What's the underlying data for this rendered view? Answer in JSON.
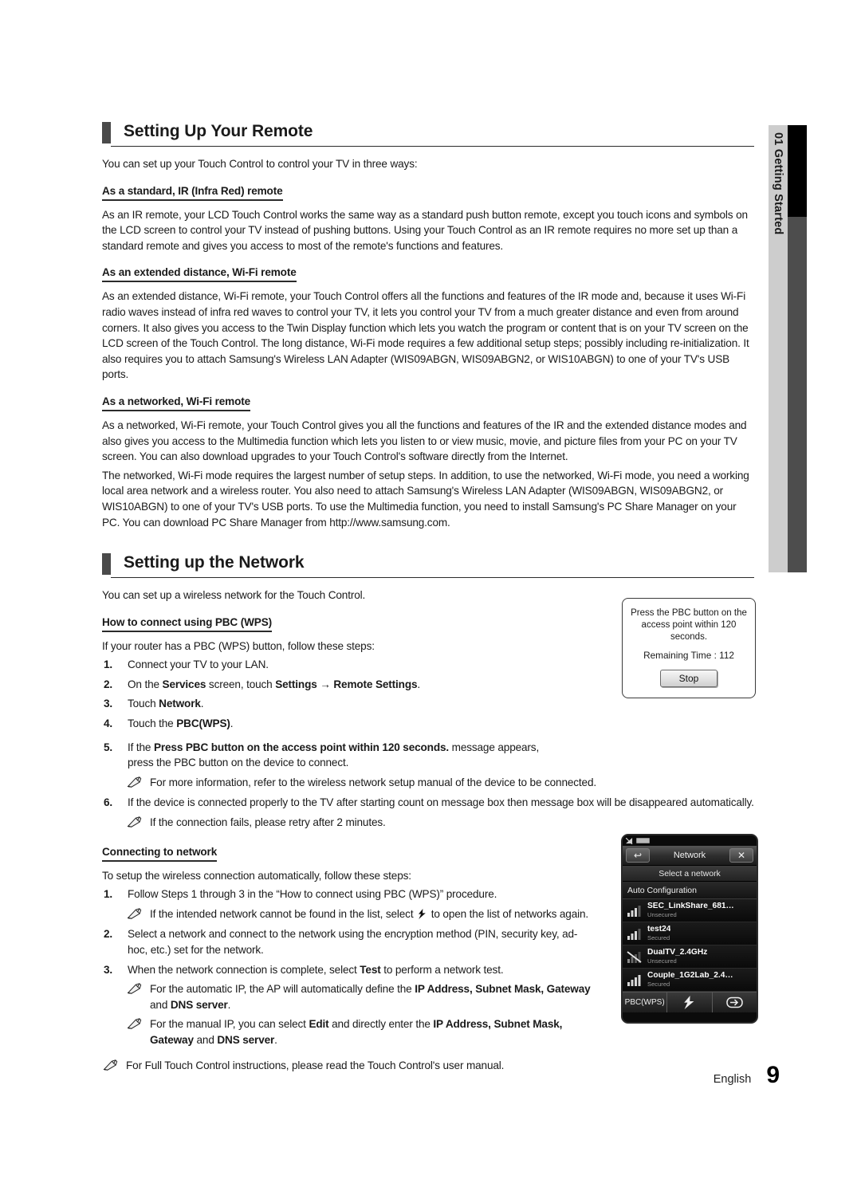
{
  "side_tab": {
    "label": "01  Getting Started"
  },
  "sections": [
    {
      "title": "Setting Up Your Remote",
      "lead": "You can set up your Touch Control to control your TV in three ways:",
      "subsections": [
        {
          "heading": "As a standard, IR (Infra Red) remote",
          "paragraphs": [
            "As an IR remote, your LCD Touch Control works the same way as a standard push button remote, except you touch icons and symbols on the LCD screen to control your TV instead of pushing buttons. Using your Touch Control as an IR remote requires no more set up than a standard remote and gives you access to most of the remote's functions and features."
          ]
        },
        {
          "heading": "As an extended distance, Wi-Fi remote",
          "paragraphs": [
            "As an extended distance, Wi-Fi remote, your Touch Control offers all the functions and features of the IR mode and, because it uses Wi-Fi radio waves instead of infra red waves to control your TV, it lets you control your TV from a much greater distance and even from around corners. It also gives you access to the Twin Display function which lets you watch the program or content that is on your TV screen on the LCD screen of the Touch Control. The long distance, Wi-Fi mode requires a few additional setup steps; possibly including re-initialization. It also requires you to attach Samsung's Wireless LAN Adapter (WIS09ABGN, WIS09ABGN2, or WIS10ABGN) to one of your TV's USB ports."
          ]
        },
        {
          "heading": "As a networked, Wi-Fi remote",
          "paragraphs": [
            "As a networked, Wi-Fi remote, your Touch Control gives you all the functions and features of the IR and the extended distance modes and also gives you access to the Multimedia function which lets you listen to or view music, movie, and picture files from your PC on your TV screen. You can also download upgrades to your Touch Control's software directly from the Internet.",
            "The networked, Wi-Fi mode requires the largest number of setup steps. In addition, to use the networked, Wi-Fi mode, you need a working local area network and a wireless router. You also need to attach Samsung's Wireless LAN Adapter (WIS09ABGN, WIS09ABGN2, or WIS10ABGN) to one of your TV's USB ports. To use the Multimedia function, you need to install Samsung's PC Share Manager on your PC. You can download PC Share Manager from http://www.samsung.com."
          ]
        }
      ]
    },
    {
      "title": "Setting up the Network",
      "lead": "You can set up a wireless network for the Touch Control."
    }
  ],
  "pbc_section": {
    "heading": "How to connect using PBC (WPS)",
    "lead": "If your router has a PBC (WPS) button, follow these steps:",
    "steps": [
      {
        "num": "1.",
        "text": "Connect your TV to your LAN."
      },
      {
        "num": "2.",
        "text": "On the Services screen, touch Settings → Remote Settings."
      },
      {
        "num": "3.",
        "text": "Touch Network."
      },
      {
        "num": "4.",
        "text": "Touch the PBC(WPS)."
      },
      {
        "num": "5.",
        "text": "If the Press PBC button on the access point within 120 seconds. message appears, press the PBC button on the device to connect."
      },
      {
        "num": "6.",
        "text": "If the device is connected properly to the TV after starting count on message box then message box will be disappeared automatically."
      }
    ],
    "note_after_5": "For more information, refer to the wireless network setup manual of the device to be connected.",
    "note_after_6": "If the connection fails, please retry after 2 minutes."
  },
  "connect_section": {
    "heading": "Connecting to network",
    "lead": "To setup the wireless connection automatically, follow these steps:",
    "steps": [
      {
        "num": "1.",
        "text": "Follow Steps 1 through 3 in the “How to connect using PBC (WPS)” procedure."
      },
      {
        "num": "2.",
        "text": "Select a network and connect to the network using the encryption method (PIN, security key, ad-hoc, etc.) set for the network."
      },
      {
        "num": "3.",
        "text": "When the network connection is complete, select Test to perform a network test."
      }
    ],
    "note_after_1_a": "If the intended network cannot be found in the list, select",
    "note_after_1_b": "to open the list of networks again.",
    "note_after_3_a": "For the automatic IP, the AP will automatically define the IP Address, Subnet Mask, Gateway and DNS server.",
    "note_after_3_b": "For the manual IP, you can select Edit and directly enter the IP Address, Subnet Mask, Gateway and DNS server.",
    "final_note": "For Full Touch Control instructions, please read the Touch Control's user manual."
  },
  "pbc_dialog": {
    "message": "Press the PBC button on the access point within 120 seconds.",
    "remaining": "Remaining Time : 112",
    "stop_label": "Stop"
  },
  "device": {
    "title": "Network",
    "back_glyph": "↩",
    "close_glyph": "✕",
    "subtitle": "Select a network",
    "auto_config": "Auto Configuration",
    "networks": [
      {
        "name": "SEC_LinkShare_681…",
        "security": "Unsecured",
        "strength": 3,
        "crossed": false
      },
      {
        "name": "test24",
        "security": "Secured",
        "strength": 3,
        "crossed": false
      },
      {
        "name": "DualTV_2.4GHz",
        "security": "Unsecured",
        "strength": 1,
        "crossed": true
      },
      {
        "name": "Couple_1G2Lab_2.4…",
        "security": "Secured",
        "strength": 4,
        "crossed": false
      }
    ],
    "footer": {
      "pbc_label": "PBC(WPS)",
      "refresh_glyph": "⚡",
      "enter_glyph": "↩"
    }
  },
  "footer": {
    "language": "English",
    "page": "9"
  },
  "colors": {
    "heading_bar": "#4a4a4a",
    "side_light": "#cdcdcd",
    "side_dark": "#4d4d4d",
    "side_black": "#000000"
  }
}
